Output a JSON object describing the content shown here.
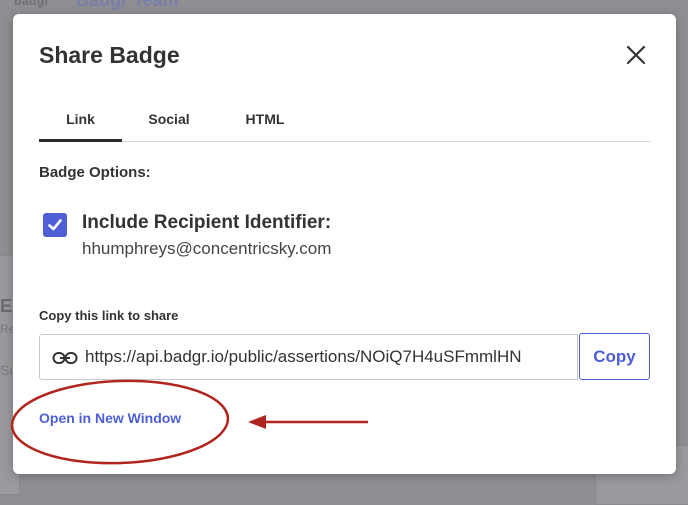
{
  "background": {
    "logo_text": "badgr",
    "team_text": "Badgr Team",
    "fragment_a": "EA",
    "fragment_b": "Re",
    "fragment_c": "Su"
  },
  "modal": {
    "title": "Share Badge",
    "close_icon": "close-x-icon",
    "tabs": [
      {
        "label": "Link",
        "active": true
      },
      {
        "label": "Social",
        "active": false
      },
      {
        "label": "HTML",
        "active": false
      }
    ],
    "badge_options_label": "Badge Options:",
    "include_recipient": {
      "label": "Include Recipient Identifier:",
      "checked": true,
      "email": "hhumphreys@concentricsky.com"
    },
    "copy_link_label": "Copy this link to share",
    "share_link": "https://api.badgr.io/public/assertions/NOiQ7H4uSFmmlHN",
    "copy_button_label": "Copy",
    "open_new_window_label": "Open in New Window"
  },
  "colors": {
    "accent": "#4e5fd6",
    "annotation": "#b0261f",
    "text": "#333333"
  }
}
